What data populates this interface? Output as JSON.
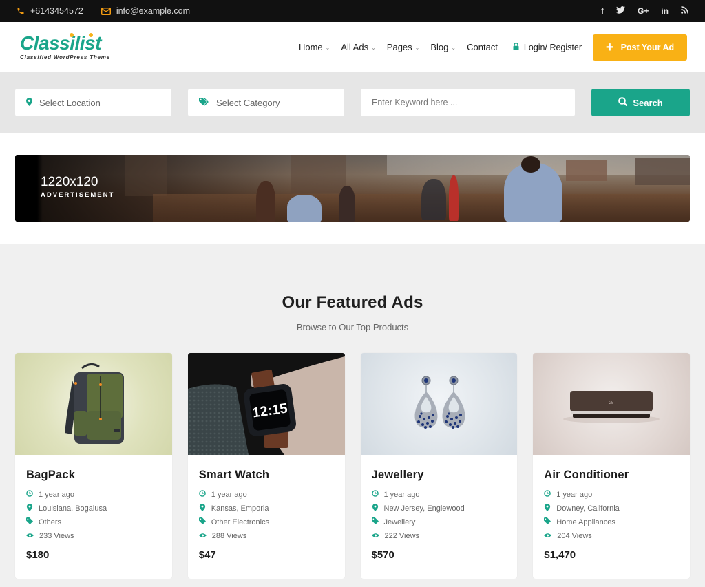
{
  "topbar": {
    "phone": "+6143454572",
    "email": "info@example.com",
    "social": [
      {
        "icon": "facebook-icon",
        "glyph": "f"
      },
      {
        "icon": "twitter-icon",
        "glyph": "🐦"
      },
      {
        "icon": "google-plus-icon",
        "glyph": "G+"
      },
      {
        "icon": "linkedin-icon",
        "glyph": "in"
      },
      {
        "icon": "rss-icon",
        "glyph": "rss"
      }
    ]
  },
  "header": {
    "logo_text": "Classilist",
    "logo_tagline": "Classified WordPress Theme",
    "nav": [
      {
        "label": "Home",
        "has_dropdown": true
      },
      {
        "label": "All Ads",
        "has_dropdown": true
      },
      {
        "label": "Pages",
        "has_dropdown": true
      },
      {
        "label": "Blog",
        "has_dropdown": true
      },
      {
        "label": "Contact",
        "has_dropdown": false
      }
    ],
    "login_label": "Login/ Register",
    "post_ad_label": "Post Your Ad",
    "chevron_glyph": "⌄",
    "plus_glyph": "+"
  },
  "search": {
    "location_label": "Select Location",
    "category_label": "Select Category",
    "keyword_placeholder": "Enter Keyword here ...",
    "keyword_value": "",
    "button_label": "Search"
  },
  "advert": {
    "size": "1220x120",
    "label": "ADVERTISEMENT"
  },
  "featured": {
    "title": "Our Featured Ads",
    "subtitle": "Browse to Our Top Products",
    "ads": [
      {
        "title": "BagPack",
        "posted": "1 year ago",
        "location": "Louisiana, Bogalusa",
        "category": "Others",
        "views": "233 Views",
        "price": "$180",
        "image": "backpack"
      },
      {
        "title": "Smart Watch",
        "posted": "1 year ago",
        "location": "Kansas, Emporia",
        "category": "Other Electronics",
        "views": "288 Views",
        "price": "$47",
        "image": "smart-watch"
      },
      {
        "title": "Jewellery",
        "posted": "1 year ago",
        "location": "New Jersey, Englewood",
        "category": "Jewellery",
        "views": "222 Views",
        "price": "$570",
        "image": "earrings"
      },
      {
        "title": "Air Conditioner",
        "posted": "1 year ago",
        "location": "Downey, California",
        "category": "Home Appliances",
        "views": "204 Views",
        "price": "$1,470",
        "image": "air-conditioner"
      }
    ],
    "watch_face_time": "12:15"
  },
  "colors": {
    "brand_green": "#1aa58a",
    "accent_yellow": "#f9b115",
    "topbar_bg": "#111111",
    "icon_orange": "#f39c12"
  }
}
